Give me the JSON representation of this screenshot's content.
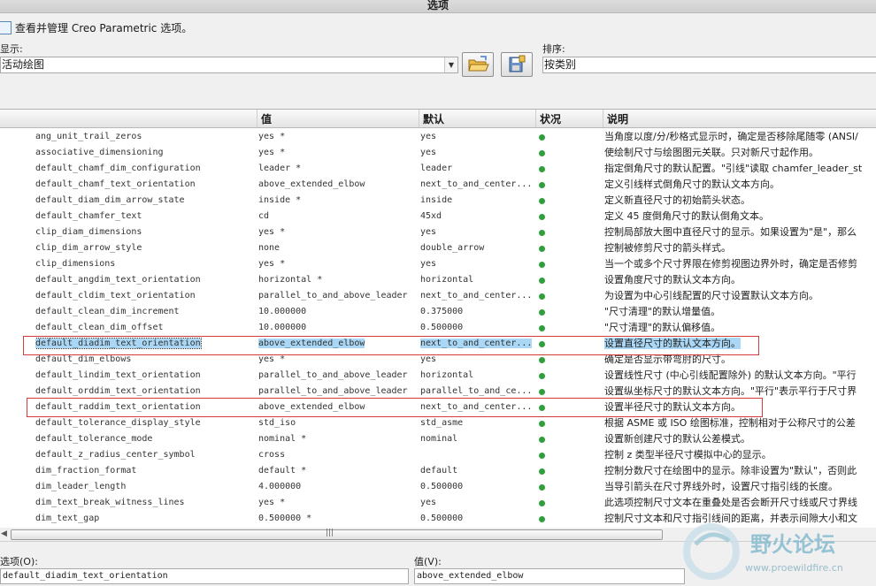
{
  "window": {
    "title": "选项"
  },
  "manage": {
    "label": "查看并管理 Creo Parametric 选项。"
  },
  "filter": {
    "show_label": "显示:",
    "show_value": "活动绘图",
    "sort_label": "排序:",
    "sort_value": "按类别"
  },
  "columns": {
    "name": "",
    "value": "值",
    "default": "默认",
    "status": "状况",
    "description": "说明"
  },
  "rows": [
    {
      "name": "ang_unit_trail_zeros",
      "value": "yes *",
      "default": "yes",
      "desc": "当角度以度/分/秒格式显示时，确定是否移除尾随零 (ANSI/"
    },
    {
      "name": "associative_dimensioning",
      "value": "yes *",
      "default": "yes",
      "desc": "使绘制尺寸与绘图图元关联。只对新尺寸起作用。"
    },
    {
      "name": "default_chamf_dim_configuration",
      "value": "leader *",
      "default": "leader",
      "desc": "指定倒角尺寸的默认配置。\"引线\"读取 chamfer_leader_st"
    },
    {
      "name": "default_chamf_text_orientation",
      "value": "above_extended_elbow",
      "default": "next_to_and_center...",
      "desc": "定义引线样式倒角尺寸的默认文本方向。"
    },
    {
      "name": "default_diam_dim_arrow_state",
      "value": "inside *",
      "default": "inside",
      "desc": "定义新直径尺寸的初始箭头状态。"
    },
    {
      "name": "default_chamfer_text",
      "value": "cd",
      "default": "45xd",
      "desc": "定义 45 度倒角尺寸的默认倒角文本。"
    },
    {
      "name": "clip_diam_dimensions",
      "value": "yes *",
      "default": "yes",
      "desc": "控制局部放大图中直径尺寸的显示。如果设置为\"是\"，那么"
    },
    {
      "name": "clip_dim_arrow_style",
      "value": "none",
      "default": "double_arrow",
      "desc": "控制被修剪尺寸的箭头样式。"
    },
    {
      "name": "clip_dimensions",
      "value": "yes *",
      "default": "yes",
      "desc": "当一个或多个尺寸界限在修剪视图边界外时，确定是否修剪"
    },
    {
      "name": "default_angdim_text_orientation",
      "value": "horizontal *",
      "default": "horizontal",
      "desc": "设置角度尺寸的默认文本方向。"
    },
    {
      "name": "default_cldim_text_orientation",
      "value": "parallel_to_and_above_leader",
      "default": "next_to_and_center...",
      "desc": "为设置为中心引线配置的尺寸设置默认文本方向。"
    },
    {
      "name": "default_clean_dim_increment",
      "value": "10.000000",
      "default": "0.375000",
      "desc": "\"尺寸清理\"的默认增量值。"
    },
    {
      "name": "default_clean_dim_offset",
      "value": "10.000000",
      "default": "0.500000",
      "desc": "\"尺寸清理\"的默认偏移值。"
    },
    {
      "name": "default_diadim_text_orientation",
      "value": "above_extended_elbow",
      "default": "next_to_and_center...",
      "desc": "设置直径尺寸的默认文本方向。",
      "selected": true
    },
    {
      "name": "default_dim_elbows",
      "value": "yes *",
      "default": "yes",
      "desc": "确定是否显示带弯肘的尺寸。"
    },
    {
      "name": "default_lindim_text_orientation",
      "value": "parallel_to_and_above_leader",
      "default": "horizontal",
      "desc": "设置线性尺寸 (中心引线配置除外) 的默认文本方向。\"平行"
    },
    {
      "name": "default_orddim_text_orientation",
      "value": "parallel_to_and_above_leader",
      "default": "parallel_to_and_ce...",
      "desc": "设置纵坐标尺寸的默认文本方向。\"平行\"表示平行于尺寸界"
    },
    {
      "name": "default_raddim_text_orientation",
      "value": "above_extended_elbow",
      "default": "next_to_and_center...",
      "desc": "设置半径尺寸的默认文本方向。"
    },
    {
      "name": "default_tolerance_display_style",
      "value": "std_iso",
      "default": "std_asme",
      "desc": "根据 ASME 或 ISO 绘图标准，控制相对于公称尺寸的公差"
    },
    {
      "name": "default_tolerance_mode",
      "value": "nominal *",
      "default": "nominal",
      "desc": "设置新创建尺寸的默认公差模式。"
    },
    {
      "name": "default_z_radius_center_symbol",
      "value": "cross",
      "default": "",
      "desc": "控制 z 类型半径尺寸模拟中心的显示。"
    },
    {
      "name": "dim_fraction_format",
      "value": "default *",
      "default": "default",
      "desc": "控制分数尺寸在绘图中的显示。除非设置为\"默认\"，否则此"
    },
    {
      "name": "dim_leader_length",
      "value": "4.000000",
      "default": "0.500000",
      "desc": "当导引箭头在尺寸界线外时，设置尺寸指引线的长度。"
    },
    {
      "name": "dim_text_break_witness_lines",
      "value": "yes *",
      "default": "yes",
      "desc": "此选项控制尺寸文本在重叠处是否会断开尺寸线或尺寸界线"
    },
    {
      "name": "dim_text_gap",
      "value": "0.500000 *",
      "default": "0.500000",
      "desc": "控制尺寸文本和尺寸指引线间的距离，并表示间隙大小和文"
    }
  ],
  "scrollbar": {
    "grip": "|||"
  },
  "bottom": {
    "option_label": "选项(O):",
    "option_value": "default_diadim_text_orientation",
    "value_label": "值(V):",
    "value_value": "above_extended_elbow"
  },
  "watermark": {
    "text": "野火论坛",
    "url": "www.proewildfire.cn"
  },
  "colors": {
    "status_ok": "#2f9e3c",
    "selection": "#a9d7f5",
    "annotation": "#d43c3c"
  }
}
